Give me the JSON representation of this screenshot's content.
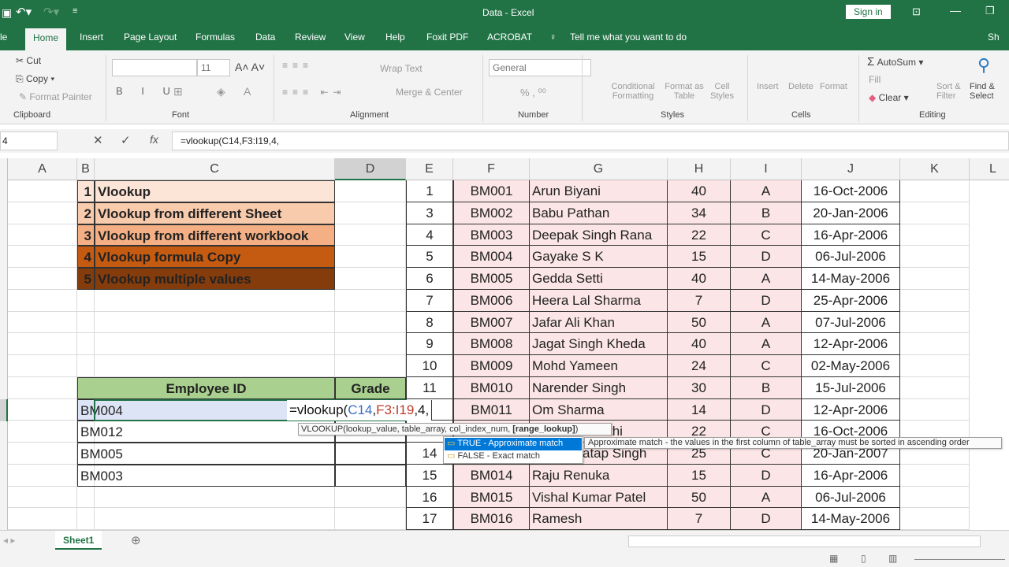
{
  "window": {
    "title": "Data - Excel",
    "sign_in": "Sign in"
  },
  "tabs": [
    {
      "label": "le"
    },
    {
      "label": "Home"
    },
    {
      "label": "Insert"
    },
    {
      "label": "Page Layout"
    },
    {
      "label": "Formulas"
    },
    {
      "label": "Data"
    },
    {
      "label": "Review"
    },
    {
      "label": "View"
    },
    {
      "label": "Help"
    },
    {
      "label": "Foxit PDF"
    },
    {
      "label": "ACROBAT"
    }
  ],
  "tell_me": "Tell me what you want to do",
  "share": "Sh",
  "ribbon": {
    "clipboard": {
      "cut": "Cut",
      "copy": "Copy",
      "format_painter": "Format Painter",
      "label": "Clipboard"
    },
    "font": {
      "size": "11",
      "label": "Font"
    },
    "alignment": {
      "wrap": "Wrap Text",
      "merge": "Merge & Center",
      "label": "Alignment"
    },
    "number": {
      "format": "General",
      "label": "Number"
    },
    "styles": {
      "cond": "Conditional Formatting",
      "table": "Format as Table",
      "cell": "Cell Styles",
      "label": "Styles"
    },
    "cells": {
      "insert": "Insert",
      "delete": "Delete",
      "format": "Format",
      "label": "Cells"
    },
    "editing": {
      "autosum": "AutoSum",
      "fill": "Fill",
      "clear": "Clear",
      "sort": "Sort & Filter",
      "find": "Find & Select",
      "label": "Editing"
    }
  },
  "formula_bar": {
    "name_box": "4",
    "formula": "=vlookup(C14,F3:I19,4,"
  },
  "columns": [
    "A",
    "B",
    "C",
    "D",
    "E",
    "F",
    "G",
    "H",
    "I",
    "J",
    "K",
    "L"
  ],
  "menu_list": [
    {
      "num": "1",
      "label": "Vlookup",
      "color": "#fce4d6",
      "text": "#111"
    },
    {
      "num": "2",
      "label": "Vlookup from different Sheet",
      "color": "#f8cbad",
      "text": "#111"
    },
    {
      "num": "3",
      "label": "Vlookup from different workbook",
      "color": "#f4b084",
      "text": "#111"
    },
    {
      "num": "4",
      "label": "Vlookup formula Copy",
      "color": "#c55a11",
      "text": "#111"
    },
    {
      "num": "5",
      "label": "Vlookup multiple values",
      "color": "#843c0c",
      "text": "#111"
    }
  ],
  "lookup_table": {
    "headers": [
      "Employee ID",
      "Grade"
    ],
    "ids": [
      "BM004",
      "BM012",
      "BM005",
      "BM003"
    ],
    "editing_formula": "=vlookup(",
    "arg1": "C14",
    "arg2": "F3:I19",
    "rest": ",4,"
  },
  "employees": [
    [
      "1",
      "BM001",
      "Arun  Biyani",
      "40",
      "A",
      "16-Oct-2006"
    ],
    [
      "3",
      "BM002",
      "Babu  Pathan",
      "34",
      "B",
      "20-Jan-2006"
    ],
    [
      "4",
      "BM003",
      "Deepak Singh Rana",
      "22",
      "C",
      "16-Apr-2006"
    ],
    [
      "5",
      "BM004",
      "Gayake S K",
      "15",
      "D",
      "06-Jul-2006"
    ],
    [
      "6",
      "BM005",
      "Gedda  Setti",
      "40",
      "A",
      "14-May-2006"
    ],
    [
      "7",
      "BM006",
      "Heera Lal Sharma",
      "7",
      "D",
      "25-Apr-2006"
    ],
    [
      "8",
      "BM007",
      "Jafar Ali Khan",
      "50",
      "A",
      "07-Jul-2006"
    ],
    [
      "9",
      "BM008",
      "Jagat Singh Kheda",
      "40",
      "A",
      "12-Apr-2006"
    ],
    [
      "10",
      "BM009",
      "Mohd Yameen",
      "24",
      "C",
      "02-May-2006"
    ],
    [
      "11",
      "BM010",
      "Narender Singh",
      "30",
      "B",
      "15-Jul-2006"
    ],
    [
      "",
      "BM011",
      "Om Sharma",
      "14",
      "D",
      "12-Apr-2006"
    ],
    [
      "",
      "",
      "thi",
      "22",
      "C",
      "16-Oct-2006"
    ],
    [
      "14",
      "",
      "Pratap Singh",
      "25",
      "C",
      "20-Jan-2007"
    ],
    [
      "15",
      "BM014",
      "Raju Renuka",
      "15",
      "D",
      "16-Apr-2006"
    ],
    [
      "16",
      "BM015",
      "Vishal Kumar Patel",
      "50",
      "A",
      "06-Jul-2006"
    ],
    [
      "17",
      "BM016",
      "Ramesh",
      "7",
      "D",
      "14-May-2006"
    ]
  ],
  "tooltip": {
    "signature": "VLOOKUP(lookup_value, table_array, col_index_num, ",
    "current_arg": "[range_lookup]",
    "close": ")"
  },
  "autocomplete": [
    {
      "label": "TRUE - Approximate match",
      "selected": true
    },
    {
      "label": "FALSE - Exact match",
      "selected": false
    }
  ],
  "autocomplete_hint": "Approximate match - the values in the first column of table_array must be sorted in ascending order",
  "sheets": [
    {
      "label": "Sheet1",
      "active": true
    }
  ],
  "colors": {
    "brand": "#217346",
    "pink": "#fbe5e6",
    "header_green": "#a9d08e"
  }
}
